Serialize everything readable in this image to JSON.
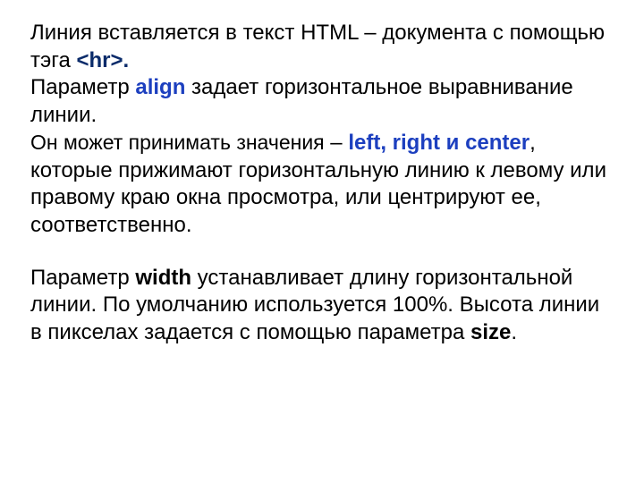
{
  "para1": {
    "t1": "Линия вставляется в текст HTML – документа с помощью тэга ",
    "tag": "<hr>.",
    "t2": "Параметр ",
    "align_kw": "align",
    "t3": " задает горизонтальное выравнивание линии."
  },
  "para2": {
    "t1": "Он может принимать значения",
    "dash": " – ",
    "vals": "left, right  и center",
    "t2": ", которые прижимают горизонтальную линию к левому или правому краю окна просмотра, или центрируют ее, соответственно."
  },
  "para3": {
    "t1": "Параметр    ",
    "width_kw": "width",
    "t2": " устанавливает длину горизонтальной линии. По умолчанию используется 100%.  Высота линии в пикселах задается с помощью параметра  ",
    "size_kw": "size",
    "t3": "."
  }
}
